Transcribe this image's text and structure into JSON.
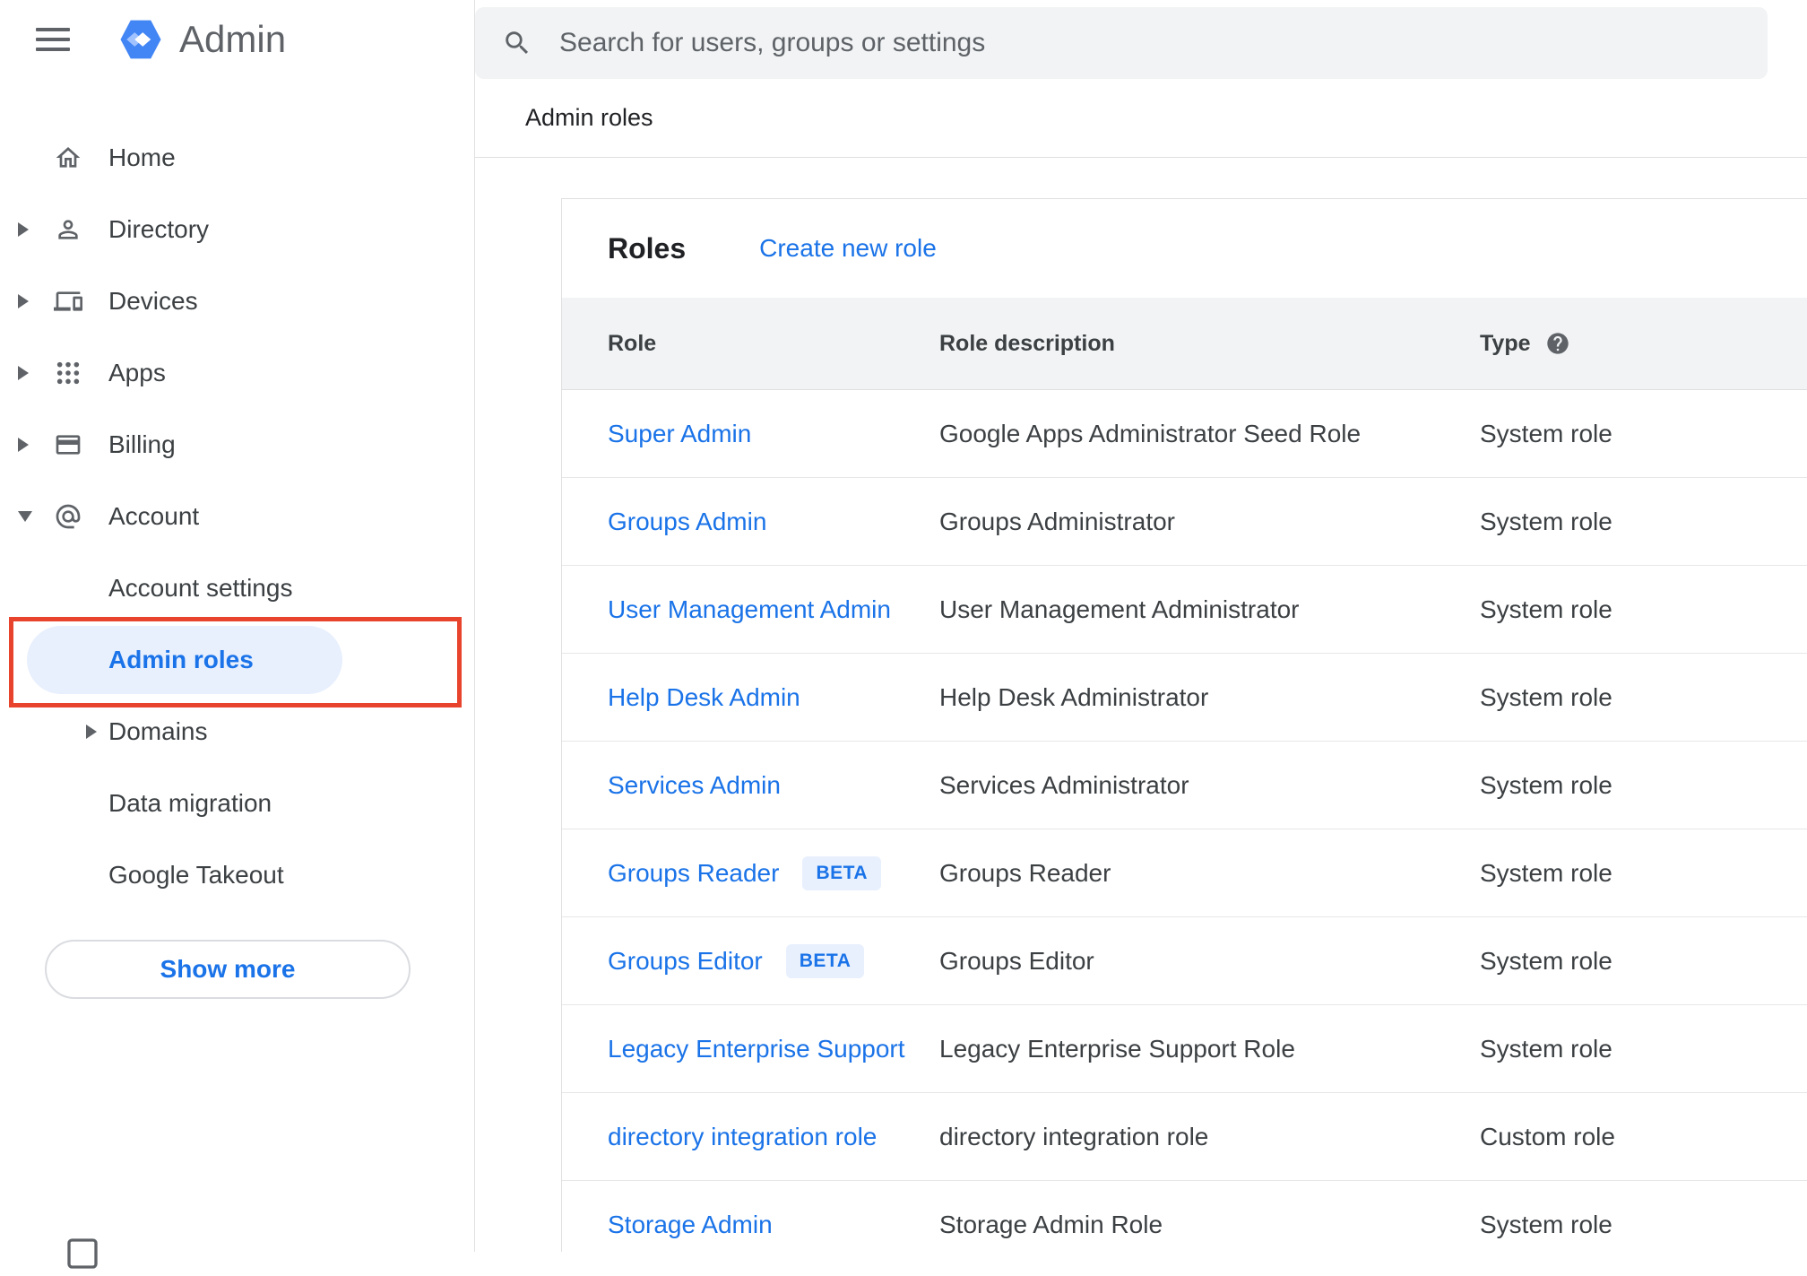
{
  "colors": {
    "accent_blue": "#1a73e8",
    "logo_blue": "#4285f4",
    "selected_item_bg": "#e8f0fe",
    "annotation_red": "#e8432d",
    "search_bg": "#f1f3f4",
    "table_header_bg": "#f1f3f4",
    "divider": "#e0e0e0",
    "text_primary": "#202124",
    "text_secondary": "#3c4043",
    "icon_gray": "#5f6368"
  },
  "header": {
    "app_title": "Admin",
    "search_placeholder": "Search for users, groups or settings"
  },
  "breadcrumb": "Admin roles",
  "sidebar": {
    "items": [
      {
        "label": "Home"
      },
      {
        "label": "Directory"
      },
      {
        "label": "Devices"
      },
      {
        "label": "Apps"
      },
      {
        "label": "Billing"
      },
      {
        "label": "Account"
      }
    ],
    "account_children": [
      {
        "label": "Account settings"
      },
      {
        "label": "Admin roles",
        "selected": true
      },
      {
        "label": "Domains"
      },
      {
        "label": "Data migration"
      },
      {
        "label": "Google Takeout"
      }
    ],
    "show_more_label": "Show more"
  },
  "main": {
    "title": "Roles",
    "create_link_label": "Create new role",
    "table": {
      "columns": [
        "Role",
        "Role description",
        "Type"
      ],
      "rows": [
        {
          "role": "Super Admin",
          "badge": "",
          "description": "Google Apps Administrator Seed Role",
          "type": "System role"
        },
        {
          "role": "Groups Admin",
          "badge": "",
          "description": "Groups Administrator",
          "type": "System role"
        },
        {
          "role": "User Management Admin",
          "badge": "",
          "description": "User Management Administrator",
          "type": "System role"
        },
        {
          "role": "Help Desk Admin",
          "badge": "",
          "description": "Help Desk Administrator",
          "type": "System role"
        },
        {
          "role": "Services Admin",
          "badge": "",
          "description": "Services Administrator",
          "type": "System role"
        },
        {
          "role": "Groups Reader",
          "badge": "BETA",
          "description": "Groups Reader",
          "type": "System role"
        },
        {
          "role": "Groups Editor",
          "badge": "BETA",
          "description": "Groups Editor",
          "type": "System role"
        },
        {
          "role": "Legacy Enterprise Support",
          "badge": "",
          "description": "Legacy Enterprise Support Role",
          "type": "System role"
        },
        {
          "role": "directory integration role",
          "badge": "",
          "description": "directory integration role",
          "type": "Custom role"
        },
        {
          "role": "Storage Admin",
          "badge": "",
          "description": "Storage Admin Role",
          "type": "System role"
        }
      ]
    }
  }
}
